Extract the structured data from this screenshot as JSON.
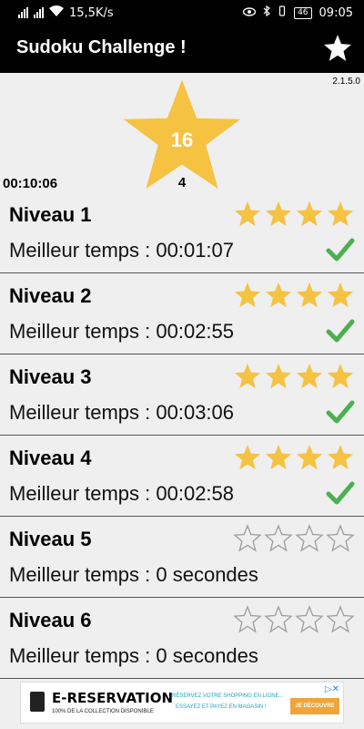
{
  "status_bar": {
    "speed": "15,5K/s",
    "battery": "46",
    "time": "09:05"
  },
  "app": {
    "title": "Sudoku Challenge !",
    "version": "2.1.5.0"
  },
  "summary": {
    "star_total": "16",
    "star_sub": "4",
    "timer": "00:10:06"
  },
  "colors": {
    "accent": "#f5c242",
    "check": "#4caf50",
    "header": "#000000"
  },
  "levels": [
    {
      "title": "Niveau 1",
      "time": "Meilleur temps : 00:01:07",
      "stars": 4,
      "completed": true
    },
    {
      "title": "Niveau 2",
      "time": "Meilleur temps : 00:02:55",
      "stars": 4,
      "completed": true
    },
    {
      "title": "Niveau 3",
      "time": "Meilleur temps : 00:03:06",
      "stars": 4,
      "completed": true
    },
    {
      "title": "Niveau 4",
      "time": "Meilleur temps : 00:02:58",
      "stars": 4,
      "completed": true
    },
    {
      "title": "Niveau 5",
      "time": "Meilleur temps : 0 secondes",
      "stars": 0,
      "completed": false
    },
    {
      "title": "Niveau 6",
      "time": "Meilleur temps : 0 secondes",
      "stars": 0,
      "completed": false
    }
  ],
  "ad": {
    "brand": "E-RESERVATION",
    "subtitle": "100% DE LA COLLECTION DISPONIBLE",
    "line1": "RÉSERVEZ VOTRE SHOPPING EN LIGNE...",
    "line2": "ESSAYEZ ET PAYEZ EN MAGASIN !",
    "cta": "JE DÉCOUVRE"
  }
}
